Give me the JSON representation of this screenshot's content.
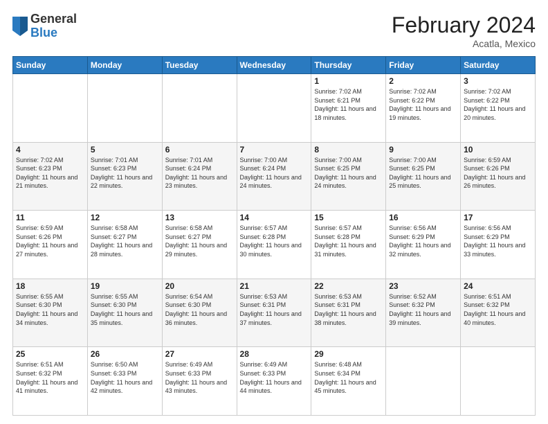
{
  "header": {
    "logo_general": "General",
    "logo_blue": "Blue",
    "month_year": "February 2024",
    "location": "Acatla, Mexico"
  },
  "weekdays": [
    "Sunday",
    "Monday",
    "Tuesday",
    "Wednesday",
    "Thursday",
    "Friday",
    "Saturday"
  ],
  "weeks": [
    [
      {
        "day": "",
        "info": ""
      },
      {
        "day": "",
        "info": ""
      },
      {
        "day": "",
        "info": ""
      },
      {
        "day": "",
        "info": ""
      },
      {
        "day": "1",
        "info": "Sunrise: 7:02 AM\nSunset: 6:21 PM\nDaylight: 11 hours and 18 minutes."
      },
      {
        "day": "2",
        "info": "Sunrise: 7:02 AM\nSunset: 6:22 PM\nDaylight: 11 hours and 19 minutes."
      },
      {
        "day": "3",
        "info": "Sunrise: 7:02 AM\nSunset: 6:22 PM\nDaylight: 11 hours and 20 minutes."
      }
    ],
    [
      {
        "day": "4",
        "info": "Sunrise: 7:02 AM\nSunset: 6:23 PM\nDaylight: 11 hours and 21 minutes."
      },
      {
        "day": "5",
        "info": "Sunrise: 7:01 AM\nSunset: 6:23 PM\nDaylight: 11 hours and 22 minutes."
      },
      {
        "day": "6",
        "info": "Sunrise: 7:01 AM\nSunset: 6:24 PM\nDaylight: 11 hours and 23 minutes."
      },
      {
        "day": "7",
        "info": "Sunrise: 7:00 AM\nSunset: 6:24 PM\nDaylight: 11 hours and 24 minutes."
      },
      {
        "day": "8",
        "info": "Sunrise: 7:00 AM\nSunset: 6:25 PM\nDaylight: 11 hours and 24 minutes."
      },
      {
        "day": "9",
        "info": "Sunrise: 7:00 AM\nSunset: 6:25 PM\nDaylight: 11 hours and 25 minutes."
      },
      {
        "day": "10",
        "info": "Sunrise: 6:59 AM\nSunset: 6:26 PM\nDaylight: 11 hours and 26 minutes."
      }
    ],
    [
      {
        "day": "11",
        "info": "Sunrise: 6:59 AM\nSunset: 6:26 PM\nDaylight: 11 hours and 27 minutes."
      },
      {
        "day": "12",
        "info": "Sunrise: 6:58 AM\nSunset: 6:27 PM\nDaylight: 11 hours and 28 minutes."
      },
      {
        "day": "13",
        "info": "Sunrise: 6:58 AM\nSunset: 6:27 PM\nDaylight: 11 hours and 29 minutes."
      },
      {
        "day": "14",
        "info": "Sunrise: 6:57 AM\nSunset: 6:28 PM\nDaylight: 11 hours and 30 minutes."
      },
      {
        "day": "15",
        "info": "Sunrise: 6:57 AM\nSunset: 6:28 PM\nDaylight: 11 hours and 31 minutes."
      },
      {
        "day": "16",
        "info": "Sunrise: 6:56 AM\nSunset: 6:29 PM\nDaylight: 11 hours and 32 minutes."
      },
      {
        "day": "17",
        "info": "Sunrise: 6:56 AM\nSunset: 6:29 PM\nDaylight: 11 hours and 33 minutes."
      }
    ],
    [
      {
        "day": "18",
        "info": "Sunrise: 6:55 AM\nSunset: 6:30 PM\nDaylight: 11 hours and 34 minutes."
      },
      {
        "day": "19",
        "info": "Sunrise: 6:55 AM\nSunset: 6:30 PM\nDaylight: 11 hours and 35 minutes."
      },
      {
        "day": "20",
        "info": "Sunrise: 6:54 AM\nSunset: 6:30 PM\nDaylight: 11 hours and 36 minutes."
      },
      {
        "day": "21",
        "info": "Sunrise: 6:53 AM\nSunset: 6:31 PM\nDaylight: 11 hours and 37 minutes."
      },
      {
        "day": "22",
        "info": "Sunrise: 6:53 AM\nSunset: 6:31 PM\nDaylight: 11 hours and 38 minutes."
      },
      {
        "day": "23",
        "info": "Sunrise: 6:52 AM\nSunset: 6:32 PM\nDaylight: 11 hours and 39 minutes."
      },
      {
        "day": "24",
        "info": "Sunrise: 6:51 AM\nSunset: 6:32 PM\nDaylight: 11 hours and 40 minutes."
      }
    ],
    [
      {
        "day": "25",
        "info": "Sunrise: 6:51 AM\nSunset: 6:32 PM\nDaylight: 11 hours and 41 minutes."
      },
      {
        "day": "26",
        "info": "Sunrise: 6:50 AM\nSunset: 6:33 PM\nDaylight: 11 hours and 42 minutes."
      },
      {
        "day": "27",
        "info": "Sunrise: 6:49 AM\nSunset: 6:33 PM\nDaylight: 11 hours and 43 minutes."
      },
      {
        "day": "28",
        "info": "Sunrise: 6:49 AM\nSunset: 6:33 PM\nDaylight: 11 hours and 44 minutes."
      },
      {
        "day": "29",
        "info": "Sunrise: 6:48 AM\nSunset: 6:34 PM\nDaylight: 11 hours and 45 minutes."
      },
      {
        "day": "",
        "info": ""
      },
      {
        "day": "",
        "info": ""
      }
    ]
  ]
}
